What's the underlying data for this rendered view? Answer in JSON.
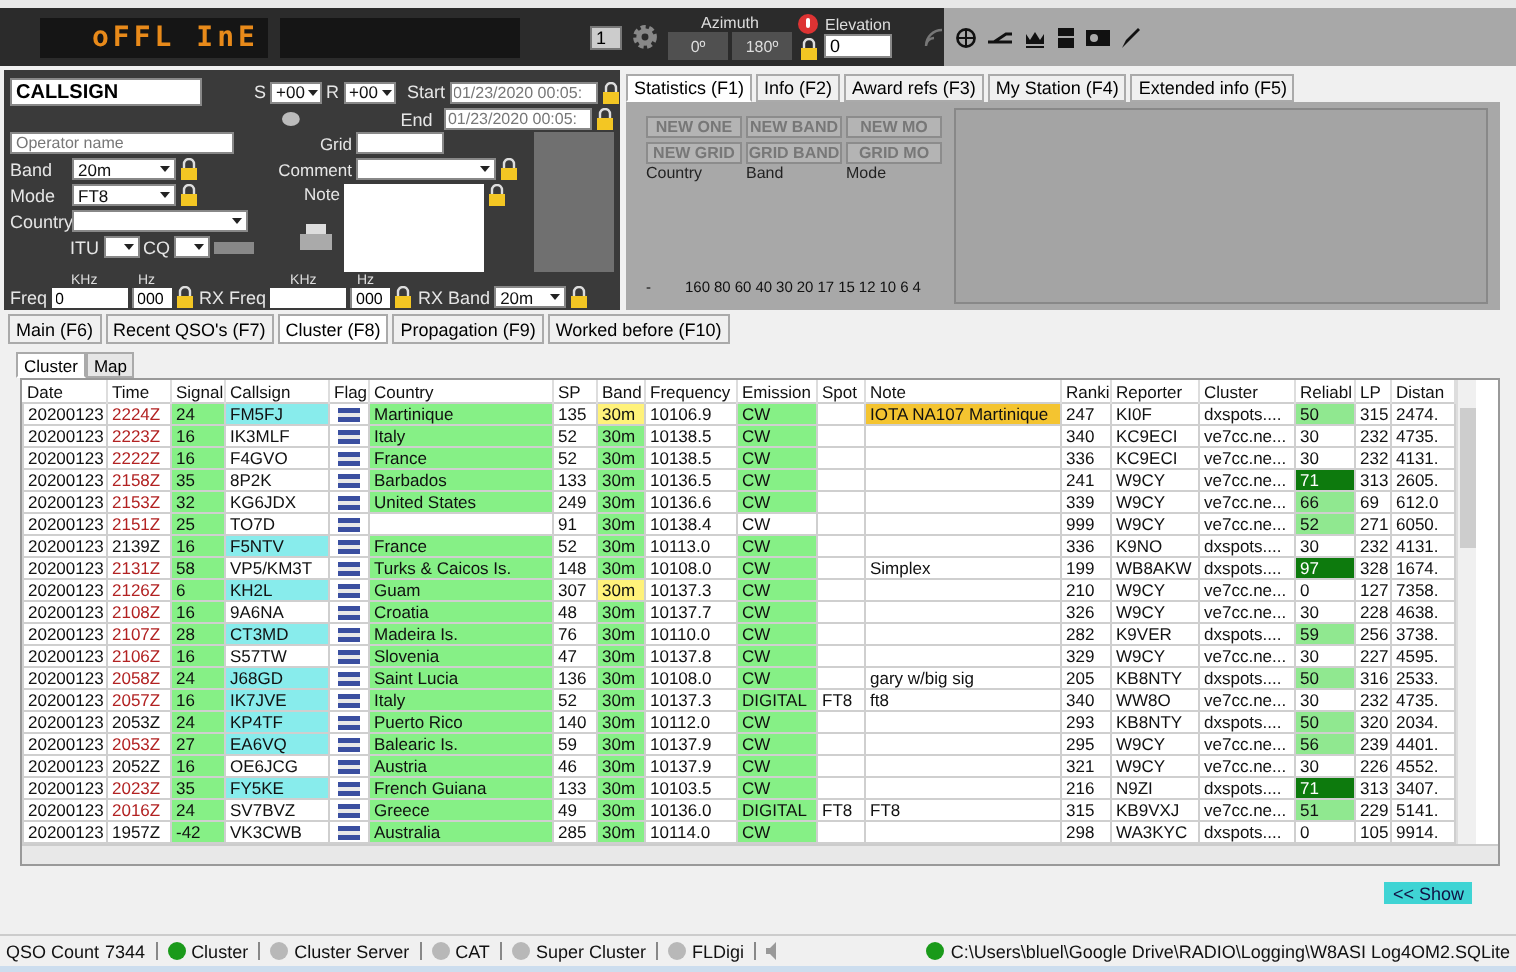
{
  "display": {
    "text": "oFFL InE"
  },
  "rotator": {
    "spin_value": "1",
    "azimuth_label": "Azimuth",
    "azimuth_buttons": [
      "0º",
      "180º"
    ],
    "elevation_label": "Elevation",
    "elevation_value": "0"
  },
  "qso_form": {
    "callsign": "CALLSIGN",
    "s_label": "S",
    "s_value": "+00",
    "r_label": "R",
    "r_value": "+00",
    "start_label": "Start",
    "start_value": "01/23/2020 00:05:",
    "end_label": "End",
    "end_value": "01/23/2020 00:05:",
    "operator_placeholder": "Operator name",
    "grid_label": "Grid",
    "band_label": "Band",
    "band_value": "20m",
    "mode_label": "Mode",
    "mode_value": "FT8",
    "comment_label": "Comment",
    "note_label": "Note",
    "country_label": "Country",
    "itu_label": "ITU",
    "cq_label": "CQ",
    "freq_units": [
      "KHz",
      "Hz"
    ],
    "rx_freq_units": [
      "KHz",
      "Hz"
    ],
    "freq_label": "Freq",
    "freq_value": "0",
    "freq_hz": "000",
    "rx_freq_label": "RX Freq",
    "rx_freq_hz": "000",
    "rx_band_label": "RX Band",
    "rx_band_value": "20m"
  },
  "info_tabs": [
    {
      "label": "Statistics (F1)",
      "selected": true
    },
    {
      "label": "Info (F2)",
      "selected": false
    },
    {
      "label": "Award refs (F3)",
      "selected": false
    },
    {
      "label": "My Station (F4)",
      "selected": false
    },
    {
      "label": "Extended info (F5)",
      "selected": false
    }
  ],
  "statistics": {
    "award_buttons": [
      "NEW ONE",
      "NEW BAND",
      "NEW MO",
      "NEW GRID",
      "GRID BAND",
      "GRID MO"
    ],
    "labels": [
      "Country",
      "Band",
      "Mode"
    ],
    "bands": [
      "-",
      "160",
      "80",
      "60",
      "40",
      "30",
      "20",
      "17",
      "15",
      "12",
      "10",
      "6",
      "4"
    ]
  },
  "main_tabs": [
    {
      "label": "Main (F6)",
      "selected": false
    },
    {
      "label": "Recent QSO's (F7)",
      "selected": false
    },
    {
      "label": "Cluster (F8)",
      "selected": true
    },
    {
      "label": "Propagation (F9)",
      "selected": false
    },
    {
      "label": "Worked before (F10)",
      "selected": false
    }
  ],
  "sub_tabs": [
    {
      "label": "Cluster",
      "selected": true
    },
    {
      "label": "Map",
      "selected": false
    }
  ],
  "cluster_table": {
    "columns": [
      "Date",
      "Time",
      "Signal",
      "Callsign",
      "Flag",
      "Country",
      "SP",
      "Band",
      "Frequency",
      "Emission",
      "Spot",
      "Note",
      "Ranki",
      "Reporter",
      "Cluster",
      "Reliabl",
      "LP",
      "Distan"
    ],
    "rows": [
      {
        "date": "20200123",
        "time": "2224Z",
        "time_alert": true,
        "signal": "24",
        "call": "FM5FJ",
        "call_hl": true,
        "country": "Martinique",
        "country_hl": true,
        "sp": "135",
        "band": "30m",
        "band_hl": true,
        "freq": "10106.9",
        "emission": "CW",
        "emission_hl": true,
        "spot": "",
        "note": "IOTA NA107 Martinique",
        "note_hl": true,
        "rank": "247",
        "reporter": "KI0F",
        "cluster": "dxspots....",
        "rel": "50",
        "rel_hl": true,
        "rel_strong": false,
        "lp": "315",
        "dist": "2474."
      },
      {
        "date": "20200123",
        "time": "2223Z",
        "time_alert": true,
        "signal": "16",
        "call": "IK3MLF",
        "call_hl": false,
        "country": "Italy",
        "country_hl": true,
        "sp": "52",
        "band": "30m",
        "band_hl": false,
        "freq": "10138.5",
        "emission": "CW",
        "emission_hl": true,
        "spot": "",
        "note": "",
        "note_hl": false,
        "rank": "340",
        "reporter": "KC9ECI",
        "cluster": "ve7cc.ne...",
        "rel": "30",
        "rel_hl": false,
        "rel_strong": false,
        "lp": "232",
        "dist": "4735."
      },
      {
        "date": "20200123",
        "time": "2222Z",
        "time_alert": true,
        "signal": "16",
        "call": "F4GVO",
        "call_hl": false,
        "country": "France",
        "country_hl": true,
        "sp": "52",
        "band": "30m",
        "band_hl": false,
        "freq": "10138.5",
        "emission": "CW",
        "emission_hl": true,
        "spot": "",
        "note": "",
        "note_hl": false,
        "rank": "336",
        "reporter": "KC9ECI",
        "cluster": "ve7cc.ne...",
        "rel": "30",
        "rel_hl": false,
        "rel_strong": false,
        "lp": "232",
        "dist": "4131."
      },
      {
        "date": "20200123",
        "time": "2158Z",
        "time_alert": true,
        "signal": "35",
        "call": "8P2K",
        "call_hl": false,
        "country": "Barbados",
        "country_hl": true,
        "sp": "133",
        "band": "30m",
        "band_hl": false,
        "freq": "10136.5",
        "emission": "CW",
        "emission_hl": true,
        "spot": "",
        "note": "",
        "note_hl": false,
        "rank": "241",
        "reporter": "W9CY",
        "cluster": "ve7cc.ne...",
        "rel": "71",
        "rel_hl": true,
        "rel_strong": true,
        "lp": "313",
        "dist": "2605."
      },
      {
        "date": "20200123",
        "time": "2153Z",
        "time_alert": true,
        "signal": "32",
        "call": "KG6JDX",
        "call_hl": false,
        "country": "United States",
        "country_hl": true,
        "sp": "249",
        "band": "30m",
        "band_hl": false,
        "freq": "10136.6",
        "emission": "CW",
        "emission_hl": true,
        "spot": "",
        "note": "",
        "note_hl": false,
        "rank": "339",
        "reporter": "W9CY",
        "cluster": "ve7cc.ne...",
        "rel": "66",
        "rel_hl": true,
        "rel_strong": false,
        "lp": "69",
        "dist": "612.0"
      },
      {
        "date": "20200123",
        "time": "2151Z",
        "time_alert": true,
        "signal": "25",
        "call": "TO7D",
        "call_hl": false,
        "country": "",
        "country_hl": false,
        "sp": "91",
        "band": "30m",
        "band_hl": false,
        "freq": "10138.4",
        "emission": "CW",
        "emission_hl": false,
        "spot": "",
        "note": "",
        "note_hl": false,
        "rank": "999",
        "reporter": "W9CY",
        "cluster": "ve7cc.ne...",
        "rel": "52",
        "rel_hl": true,
        "rel_strong": false,
        "lp": "271",
        "dist": "6050."
      },
      {
        "date": "20200123",
        "time": "2139Z",
        "time_alert": false,
        "signal": "16",
        "call": "F5NTV",
        "call_hl": true,
        "country": "France",
        "country_hl": true,
        "sp": "52",
        "band": "30m",
        "band_hl": false,
        "freq": "10113.0",
        "emission": "CW",
        "emission_hl": true,
        "spot": "",
        "note": "",
        "note_hl": false,
        "rank": "336",
        "reporter": "K9NO",
        "cluster": "dxspots....",
        "rel": "30",
        "rel_hl": false,
        "rel_strong": false,
        "lp": "232",
        "dist": "4131."
      },
      {
        "date": "20200123",
        "time": "2131Z",
        "time_alert": true,
        "signal": "58",
        "call": "VP5/KM3T",
        "call_hl": false,
        "country": "Turks & Caicos Is.",
        "country_hl": true,
        "sp": "148",
        "band": "30m",
        "band_hl": false,
        "freq": "10108.0",
        "emission": "CW",
        "emission_hl": true,
        "spot": "",
        "note": "Simplex",
        "note_hl": false,
        "rank": "199",
        "reporter": "WB8AKW",
        "cluster": "dxspots....",
        "rel": "97",
        "rel_hl": true,
        "rel_strong": true,
        "lp": "328",
        "dist": "1674."
      },
      {
        "date": "20200123",
        "time": "2126Z",
        "time_alert": true,
        "signal": "6",
        "call": "KH2L",
        "call_hl": true,
        "country": "Guam",
        "country_hl": true,
        "sp": "307",
        "band": "30m",
        "band_hl": true,
        "freq": "10137.3",
        "emission": "CW",
        "emission_hl": true,
        "spot": "",
        "note": "",
        "note_hl": false,
        "rank": "210",
        "reporter": "W9CY",
        "cluster": "ve7cc.ne...",
        "rel": "0",
        "rel_hl": false,
        "rel_strong": false,
        "lp": "127",
        "dist": "7358."
      },
      {
        "date": "20200123",
        "time": "2108Z",
        "time_alert": true,
        "signal": "16",
        "call": "9A6NA",
        "call_hl": false,
        "country": "Croatia",
        "country_hl": true,
        "sp": "48",
        "band": "30m",
        "band_hl": false,
        "freq": "10137.7",
        "emission": "CW",
        "emission_hl": true,
        "spot": "",
        "note": "",
        "note_hl": false,
        "rank": "326",
        "reporter": "W9CY",
        "cluster": "ve7cc.ne...",
        "rel": "30",
        "rel_hl": false,
        "rel_strong": false,
        "lp": "228",
        "dist": "4638."
      },
      {
        "date": "20200123",
        "time": "2107Z",
        "time_alert": true,
        "signal": "28",
        "call": "CT3MD",
        "call_hl": true,
        "country": "Madeira Is.",
        "country_hl": true,
        "sp": "76",
        "band": "30m",
        "band_hl": false,
        "freq": "10110.0",
        "emission": "CW",
        "emission_hl": true,
        "spot": "",
        "note": "",
        "note_hl": false,
        "rank": "282",
        "reporter": "K9VER",
        "cluster": "dxspots....",
        "rel": "59",
        "rel_hl": true,
        "rel_strong": false,
        "lp": "256",
        "dist": "3738."
      },
      {
        "date": "20200123",
        "time": "2106Z",
        "time_alert": true,
        "signal": "16",
        "call": "S57TW",
        "call_hl": false,
        "country": "Slovenia",
        "country_hl": true,
        "sp": "47",
        "band": "30m",
        "band_hl": false,
        "freq": "10137.8",
        "emission": "CW",
        "emission_hl": true,
        "spot": "",
        "note": "",
        "note_hl": false,
        "rank": "329",
        "reporter": "W9CY",
        "cluster": "ve7cc.ne...",
        "rel": "30",
        "rel_hl": false,
        "rel_strong": false,
        "lp": "227",
        "dist": "4595."
      },
      {
        "date": "20200123",
        "time": "2058Z",
        "time_alert": true,
        "signal": "24",
        "call": "J68GD",
        "call_hl": true,
        "country": "Saint Lucia",
        "country_hl": true,
        "sp": "136",
        "band": "30m",
        "band_hl": false,
        "freq": "10108.0",
        "emission": "CW",
        "emission_hl": true,
        "spot": "",
        "note": "gary w/big sig",
        "note_hl": false,
        "rank": "205",
        "reporter": "KB8NTY",
        "cluster": "dxspots....",
        "rel": "50",
        "rel_hl": true,
        "rel_strong": false,
        "lp": "316",
        "dist": "2533."
      },
      {
        "date": "20200123",
        "time": "2057Z",
        "time_alert": true,
        "signal": "16",
        "call": "IK7JVE",
        "call_hl": true,
        "country": "Italy",
        "country_hl": true,
        "sp": "52",
        "band": "30m",
        "band_hl": false,
        "freq": "10137.3",
        "emission": "DIGITAL",
        "emission_hl": true,
        "spot": "FT8",
        "note": "ft8",
        "note_hl": false,
        "rank": "340",
        "reporter": "WW8O",
        "cluster": "ve7cc.ne...",
        "rel": "30",
        "rel_hl": false,
        "rel_strong": false,
        "lp": "232",
        "dist": "4735."
      },
      {
        "date": "20200123",
        "time": "2053Z",
        "time_alert": false,
        "signal": "24",
        "call": "KP4TF",
        "call_hl": true,
        "country": "Puerto Rico",
        "country_hl": true,
        "sp": "140",
        "band": "30m",
        "band_hl": false,
        "freq": "10112.0",
        "emission": "CW",
        "emission_hl": true,
        "spot": "",
        "note": "",
        "note_hl": false,
        "rank": "293",
        "reporter": "KB8NTY",
        "cluster": "dxspots....",
        "rel": "50",
        "rel_hl": true,
        "rel_strong": false,
        "lp": "320",
        "dist": "2034."
      },
      {
        "date": "20200123",
        "time": "2053Z",
        "time_alert": true,
        "signal": "27",
        "call": "EA6VQ",
        "call_hl": true,
        "country": "Balearic Is.",
        "country_hl": true,
        "sp": "59",
        "band": "30m",
        "band_hl": false,
        "freq": "10137.9",
        "emission": "CW",
        "emission_hl": true,
        "spot": "",
        "note": "",
        "note_hl": false,
        "rank": "295",
        "reporter": "W9CY",
        "cluster": "ve7cc.ne...",
        "rel": "56",
        "rel_hl": true,
        "rel_strong": false,
        "lp": "239",
        "dist": "4401."
      },
      {
        "date": "20200123",
        "time": "2052Z",
        "time_alert": false,
        "signal": "16",
        "call": "OE6JCG",
        "call_hl": false,
        "country": "Austria",
        "country_hl": true,
        "sp": "46",
        "band": "30m",
        "band_hl": false,
        "freq": "10137.9",
        "emission": "CW",
        "emission_hl": true,
        "spot": "",
        "note": "",
        "note_hl": false,
        "rank": "321",
        "reporter": "W9CY",
        "cluster": "ve7cc.ne...",
        "rel": "30",
        "rel_hl": false,
        "rel_strong": false,
        "lp": "226",
        "dist": "4552."
      },
      {
        "date": "20200123",
        "time": "2023Z",
        "time_alert": true,
        "signal": "35",
        "call": "FY5KE",
        "call_hl": true,
        "country": "French Guiana",
        "country_hl": true,
        "sp": "133",
        "band": "30m",
        "band_hl": false,
        "freq": "10103.5",
        "emission": "CW",
        "emission_hl": true,
        "spot": "",
        "note": "",
        "note_hl": false,
        "rank": "216",
        "reporter": "N9ZI",
        "cluster": "dxspots....",
        "rel": "71",
        "rel_hl": true,
        "rel_strong": true,
        "lp": "313",
        "dist": "3407."
      },
      {
        "date": "20200123",
        "time": "2016Z",
        "time_alert": true,
        "signal": "24",
        "call": "SV7BVZ",
        "call_hl": false,
        "country": "Greece",
        "country_hl": true,
        "sp": "49",
        "band": "30m",
        "band_hl": false,
        "freq": "10136.0",
        "emission": "DIGITAL",
        "emission_hl": true,
        "spot": "FT8",
        "note": "FT8",
        "note_hl": false,
        "rank": "315",
        "reporter": "KB9VXJ",
        "cluster": "ve7cc.ne...",
        "rel": "51",
        "rel_hl": true,
        "rel_strong": false,
        "lp": "229",
        "dist": "5141."
      },
      {
        "date": "20200123",
        "time": "1957Z",
        "time_alert": false,
        "signal": "-42",
        "call": "VK3CWB",
        "call_hl": false,
        "country": "Australia",
        "country_hl": true,
        "sp": "285",
        "band": "30m",
        "band_hl": false,
        "freq": "10114.0",
        "emission": "CW",
        "emission_hl": true,
        "spot": "",
        "note": "",
        "note_hl": false,
        "rank": "298",
        "reporter": "WA3KYC",
        "cluster": "dxspots....",
        "rel": "0",
        "rel_hl": false,
        "rel_strong": false,
        "lp": "105",
        "dist": "9914."
      }
    ]
  },
  "show_button": "<< Show",
  "status_bar": {
    "qso_count_label": "QSO Count",
    "qso_count": "7344",
    "indicators": [
      {
        "label": "Cluster",
        "on": true
      },
      {
        "label": "Cluster Server",
        "on": false
      },
      {
        "label": "CAT",
        "on": false
      },
      {
        "label": "Super Cluster",
        "on": false
      },
      {
        "label": "FLDigi",
        "on": false
      }
    ],
    "path": "C:\\Users\\bluel\\Google Drive\\RADIO\\Logging\\W8ASI Log4OM2.SQLite",
    "path_on": true
  }
}
